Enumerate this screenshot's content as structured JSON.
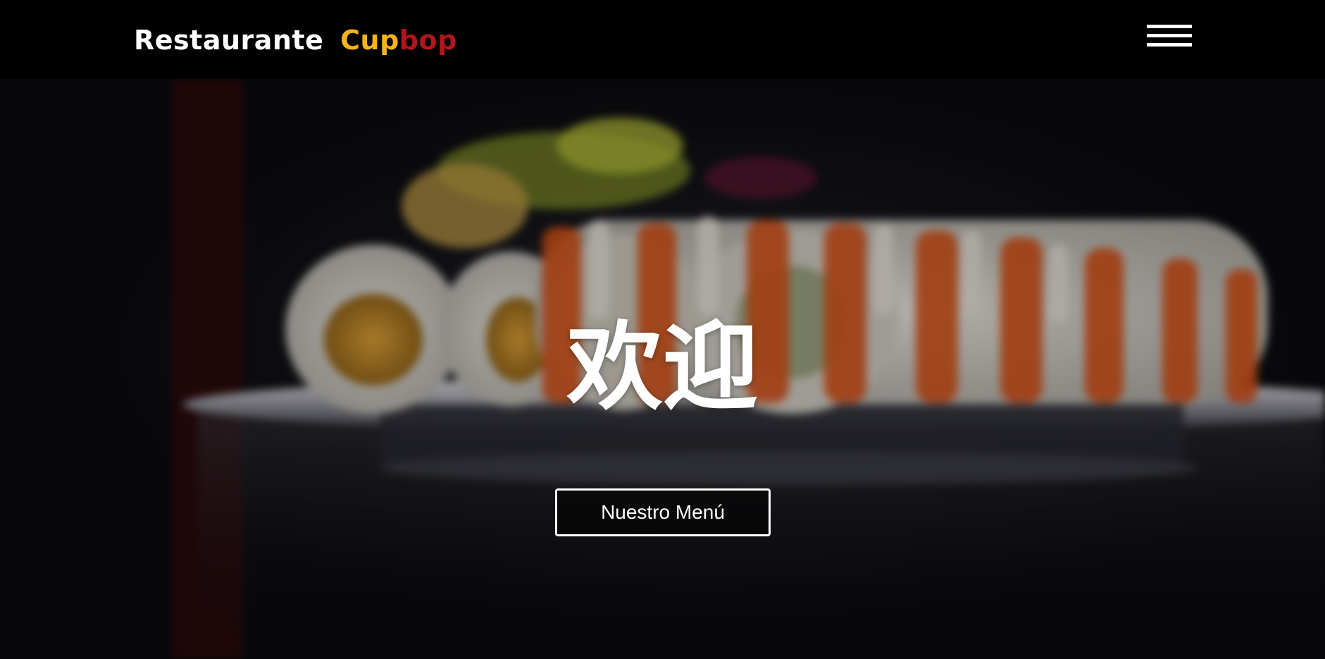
{
  "header": {
    "logo": {
      "part1": "Restaurante",
      "part2": "Cup",
      "part3": "bop"
    },
    "menu_icon": "hamburger-menu-icon"
  },
  "hero": {
    "background_image": "sushi-rolls-photo",
    "title": "欢迎",
    "button_label": "Nuestro Menú"
  },
  "colors": {
    "header_bg": "#000000",
    "logo_primary": "#ffffff",
    "logo_accent_yellow": "#f6b41a",
    "logo_accent_red": "#b0161c",
    "button_border": "#ffffff"
  }
}
